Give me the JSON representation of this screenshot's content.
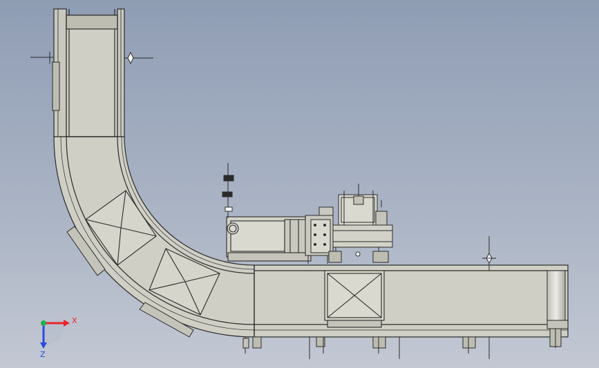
{
  "triad": {
    "x_label": "X",
    "z_label": "Z",
    "colors": {
      "x": "#e8232a",
      "y": "#22b04a",
      "z": "#2a4be0"
    }
  },
  "colors": {
    "metal": "#cfcfc5",
    "metal_dark": "#b9b9ae",
    "line": "#2a2a2a",
    "roller": "#e3e3dc"
  }
}
